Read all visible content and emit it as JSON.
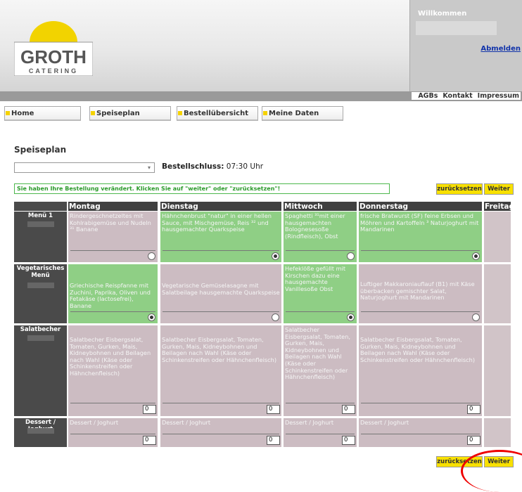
{
  "header": {
    "logo_text_top": "GROTH",
    "logo_text_bottom": "CATERING",
    "welcome": "Willkommen",
    "logout": "Abmelden"
  },
  "toplinks": [
    "AGBs",
    "Kontakt",
    "Impressum"
  ],
  "tabs": [
    "Home",
    "Speiseplan",
    "Bestellübersicht",
    "Meine Daten"
  ],
  "page": {
    "title": "Speiseplan",
    "deadline_label": "Bestellschluss:",
    "deadline_time": "07:30 Uhr",
    "message": "Sie haben Ihre Bestellung verändert. Klicken Sie auf \"weiter\" oder \"zurücksetzen\"!",
    "reset": "zurücksetzen",
    "next": "Weiter"
  },
  "days": [
    "Montag",
    "Dienstag",
    "Mittwoch",
    "Donnerstag",
    "Freitag"
  ],
  "rows": [
    {
      "label": "Menü 1",
      "cells": [
        "Rindergeschnetzeltes mit Kohlrabigemüse und Nudeln ³¹ Banane",
        "Hähnchenbrust \"natur\" in einer hellen Sauce, mit Mischgemüse, Reis ³² und hausgemachter Quarkspeise",
        "Spaghetti ³¹mit einer hausgemachten Bolognesesoße (Rindfleisch), Obst",
        "frische Bratwurst (SF) feine Erbsen und Möhren und Kartoffeln ³ Naturjoghurt mit Mandarinen"
      ]
    },
    {
      "label": "Vegetarisches Menü",
      "cells": [
        "Griechische Reispfanne mit Zuchini, Paprika, Oliven und Fetakäse (lactosefrei), Banane",
        "Vegetarische Gemüselasagne mit Salatbeilage hausgemachte Quarkspeise",
        "Hefeklöße gefüllt mit Kirschen dazu eine hausgemachte Vanillesoße Obst",
        "Luftiger Makkaroniauflauf (B1) mit Käse überbacken gemischter Salat, Naturjoghurt mit Mandarinen"
      ]
    },
    {
      "label": "Salatbecher",
      "cells": [
        "Salatbecher Eisbergsalat, Tomaten, Gurken, Mais, Kidneybohnen und Beilagen nach Wahl (Käse oder Schinkenstreifen oder Hähnchenfleisch)",
        "Salatbecher Eisbergsalat, Tomaten, Gurken, Mais, Kidneybohnen und Beilagen nach Wahl (Käse oder Schinkenstreifen oder Hähnchenfleisch)",
        "Salatbecher Eisbergsalat, Tomaten, Gurken, Mais, Kidneybohnen und Beilagen nach Wahl (Käse oder Schinkenstreifen oder Hähnchenfleisch)",
        "Salatbecher Eisbergsalat, Tomaten, Gurken, Mais, Kidneybohnen und Beilagen nach Wahl (Käse oder Schinkenstreifen oder Hähnchenfleisch)"
      ]
    },
    {
      "label": "Dessert / Joghurt",
      "cells": [
        "Dessert / Joghurt",
        "Dessert / Joghurt",
        "Dessert / Joghurt",
        "Dessert / Joghurt"
      ]
    }
  ],
  "quantity_default": "0",
  "colors": {
    "selected": "#8fcf85",
    "unselected": "#ccbcc2",
    "accent": "#f8e000"
  }
}
